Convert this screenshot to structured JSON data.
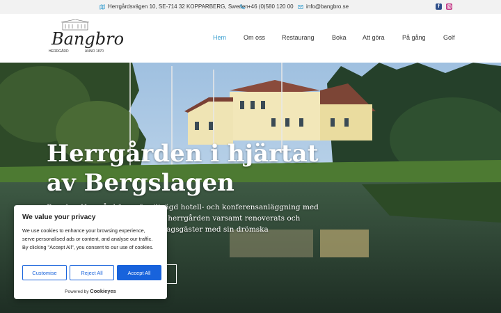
{
  "topbar": {
    "address": "Herrgårdsvägen 10, SE-714 32  KOPPARBERG, Sweden",
    "phone": "+46 (0)580 120 00",
    "email": "info@bangbro.se"
  },
  "logo": {
    "name": "Bangbro",
    "sub_left": "HERRGÅRD",
    "sub_right": "ANNO 1870"
  },
  "nav": [
    "Hem",
    "Om oss",
    "Restaurang",
    "Boka",
    "Att göra",
    "På gång",
    "Golf"
  ],
  "hero": {
    "title": "Herrgården i hjärtat av Bergslagen",
    "text": "Bangbro Herrgård är en familjeägd hotell- och konferensanläggning med anor från 1870. Sedan 1987 har herrgården varsamt renoverats och välkomnar idag hotell- och middagsgäster med sin drömska"
  },
  "cookie": {
    "title": "We value your privacy",
    "body": "We use cookies to enhance your browsing experience, serve personalised ads or content, and analyse our traffic. By clicking \"Accept All\", you consent to our use of cookies.",
    "customise": "Customise",
    "reject": "Reject All",
    "accept": "Accept All",
    "powered_prefix": "Powered by",
    "powered_brand": "Cookieyes"
  },
  "colors": {
    "accent": "#3a9fd0",
    "cookie_blue": "#1863dc",
    "topbar_bg": "#f2f2f2"
  },
  "icons": [
    "map-icon",
    "phone-icon",
    "mail-icon",
    "facebook-icon",
    "instagram-icon"
  ]
}
